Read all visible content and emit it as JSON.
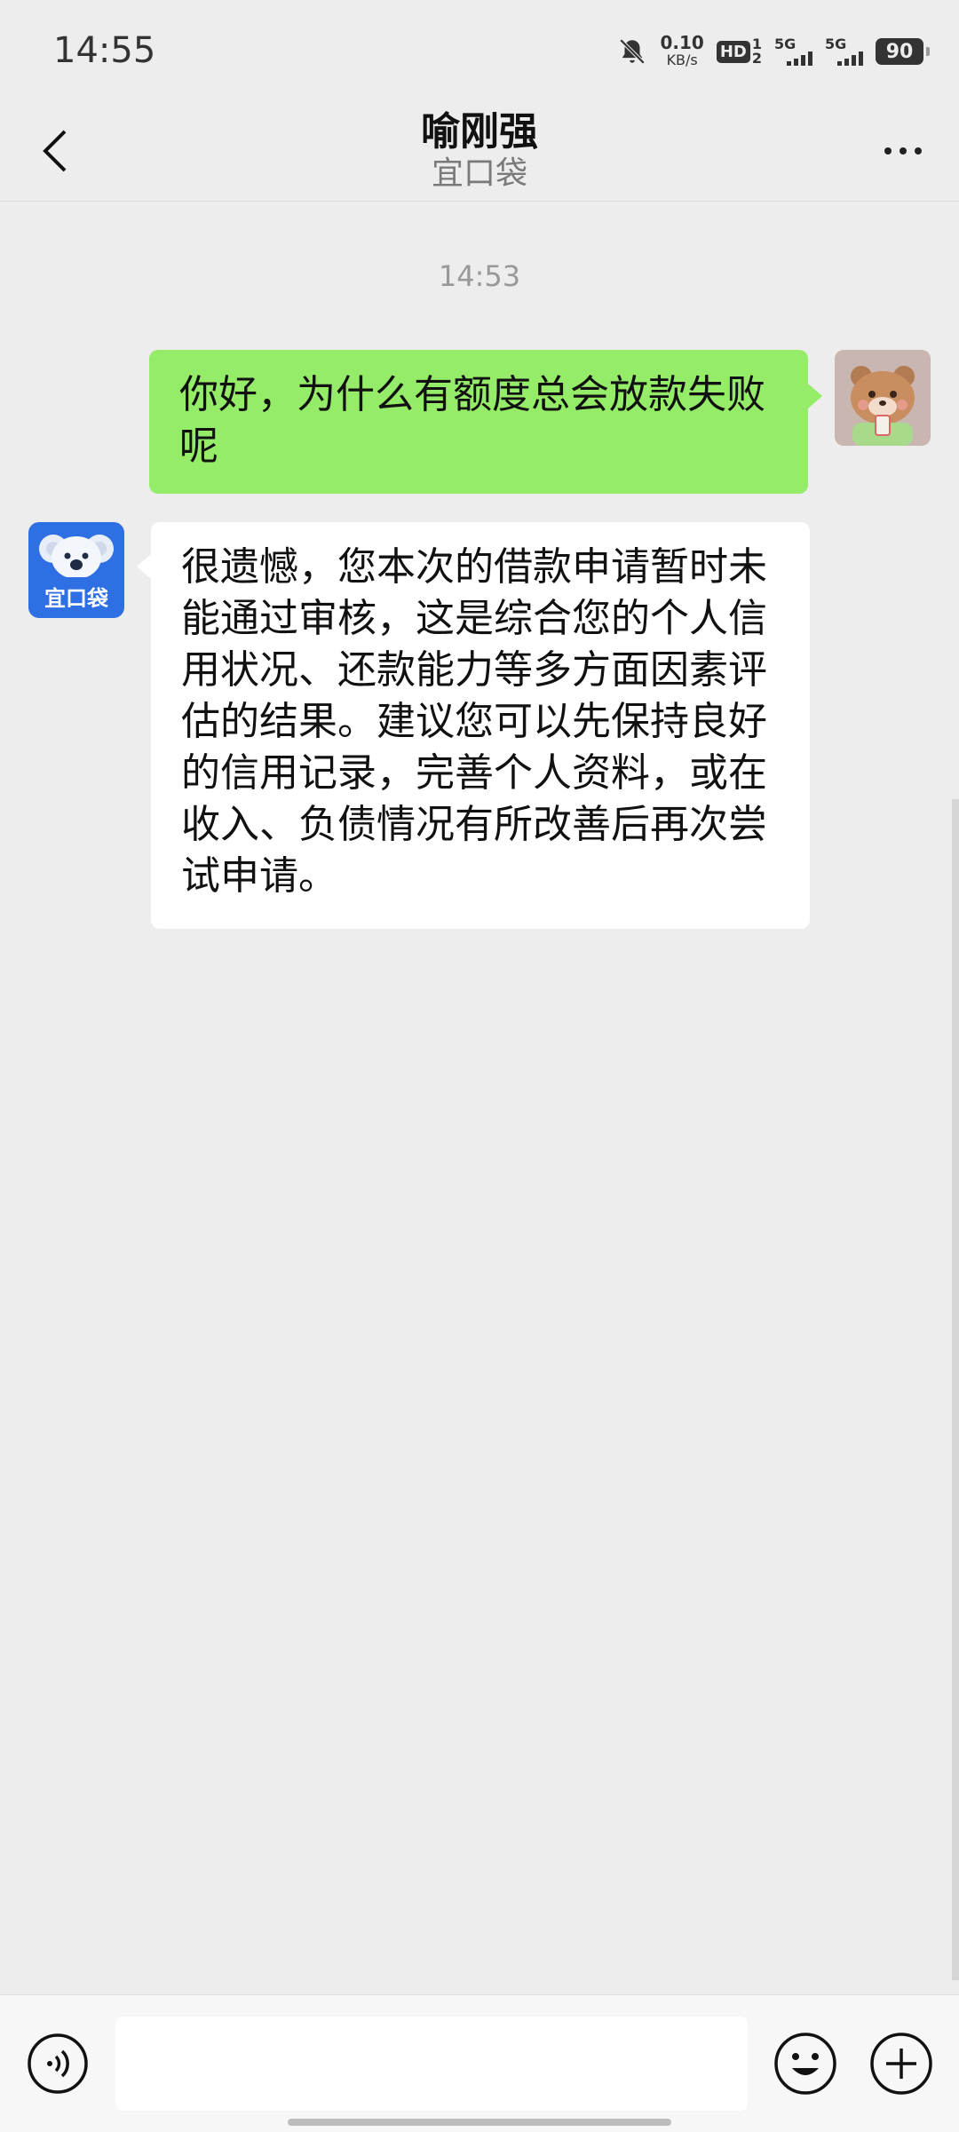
{
  "status_bar": {
    "time": "14:55",
    "net_speed": "0.10",
    "net_unit": "KB/s",
    "hd_label": "HD",
    "hd_sim_top": "1",
    "hd_sim_bottom": "2",
    "signal_1": "5G",
    "signal_2": "5G",
    "battery": "90",
    "icons": [
      "bell-muted-icon",
      "hd-voice-icon",
      "signal-icon",
      "signal-icon",
      "battery-icon"
    ]
  },
  "header": {
    "title": "喻刚强",
    "subtitle": "宜口袋",
    "back_icon": "chevron-left-icon",
    "more_icon": "more-dots-icon"
  },
  "chat": {
    "timestamp": "14:53",
    "messages": [
      {
        "direction": "outgoing",
        "text": "你好，为什么有额度总会放款失败呢",
        "avatar": "bear-avatar"
      },
      {
        "direction": "incoming",
        "text": "很遗憾，您本次的借款申请暂时未能通过审核，这是综合您的个人信用状况、还款能力等多方面因素评估的结果。建议您可以先保持良好的信用记录，完善个人资料，或在收入、负债情况有所改善后再次尝试申请。",
        "avatar": "koala-logo",
        "avatar_label": "宜口袋"
      }
    ]
  },
  "input_bar": {
    "value": "",
    "icons": [
      "voice-icon",
      "emoji-icon",
      "plus-icon"
    ]
  },
  "colors": {
    "background": "#ededed",
    "outgoing_bubble": "#95ec69",
    "incoming_bubble": "#ffffff",
    "brand_blue": "#2f6fe4"
  }
}
